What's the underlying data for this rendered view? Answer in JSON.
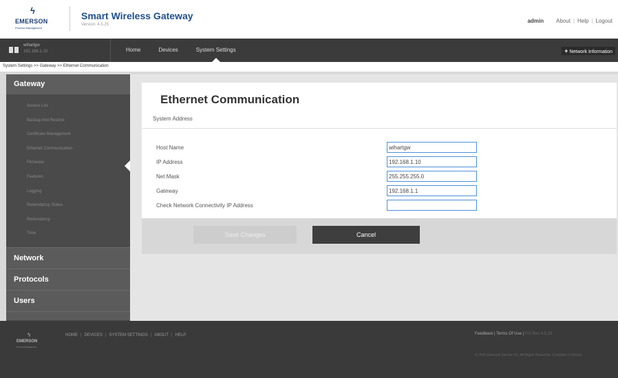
{
  "header": {
    "logo_text": "EMERSON",
    "logo_sub": "Process Management",
    "app_title": "Smart Wireless Gateway",
    "version": "Version: 4.5.25",
    "user": "admin",
    "links": [
      "About",
      "Help",
      "Logout"
    ]
  },
  "navbar": {
    "device_name": "wihartgw",
    "device_ip": "192.168.1.10",
    "items": [
      "Home",
      "Devices",
      "System Settings"
    ],
    "active": "System Settings",
    "network_info": "Network Information"
  },
  "breadcrumb": "System Settings >> Gateway >> Ethernet Communication",
  "sidebar": {
    "gateway_label": "Gateway",
    "gateway_items": [
      "Access List",
      "Backup And Restore",
      "Certificate Management",
      "Ethernet Communication",
      "Firmware",
      "Features",
      "Logging",
      "Redundancy Status",
      "Redundancy",
      "Time"
    ],
    "active_item": "Ethernet Communication",
    "sections": [
      "Network",
      "Protocols",
      "Users"
    ]
  },
  "main": {
    "title": "Ethernet Communication",
    "section": "System Address",
    "fields": [
      {
        "label": "Host Name",
        "value": "wihartgw"
      },
      {
        "label": "IP Address",
        "value": "192.168.1.10"
      },
      {
        "label": "Net Mask",
        "value": "255.255.255.0"
      },
      {
        "label": "Gateway",
        "value": "192.168.1.1"
      },
      {
        "label": "Check Network Connectivity IP Address",
        "value": ""
      }
    ],
    "save_label": "Save Changes",
    "cancel_label": "Cancel"
  },
  "footer": {
    "logo_text": "EMERSON",
    "logo_sub": "Process Management",
    "links": [
      "HOME",
      "DEVICES",
      "SYSTEM SETTINGS",
      "ABOUT",
      "HELP"
    ],
    "feedback": "Feedback",
    "terms": "Terms Of Use",
    "version": "P/2 Rev 4.5.25",
    "copyright": "© 2015 Emerson Electric Co. All Rights Reserved. Complete It Solved."
  },
  "colors": {
    "brand": "#1f4f8b",
    "nav_bg": "#3b3b3b",
    "sidebar_bg": "#4a4a4a",
    "input_border": "#4a90d9"
  },
  "icons": {
    "device": "device-icon",
    "plus": "plus-icon",
    "logo": "emerson-logo"
  }
}
